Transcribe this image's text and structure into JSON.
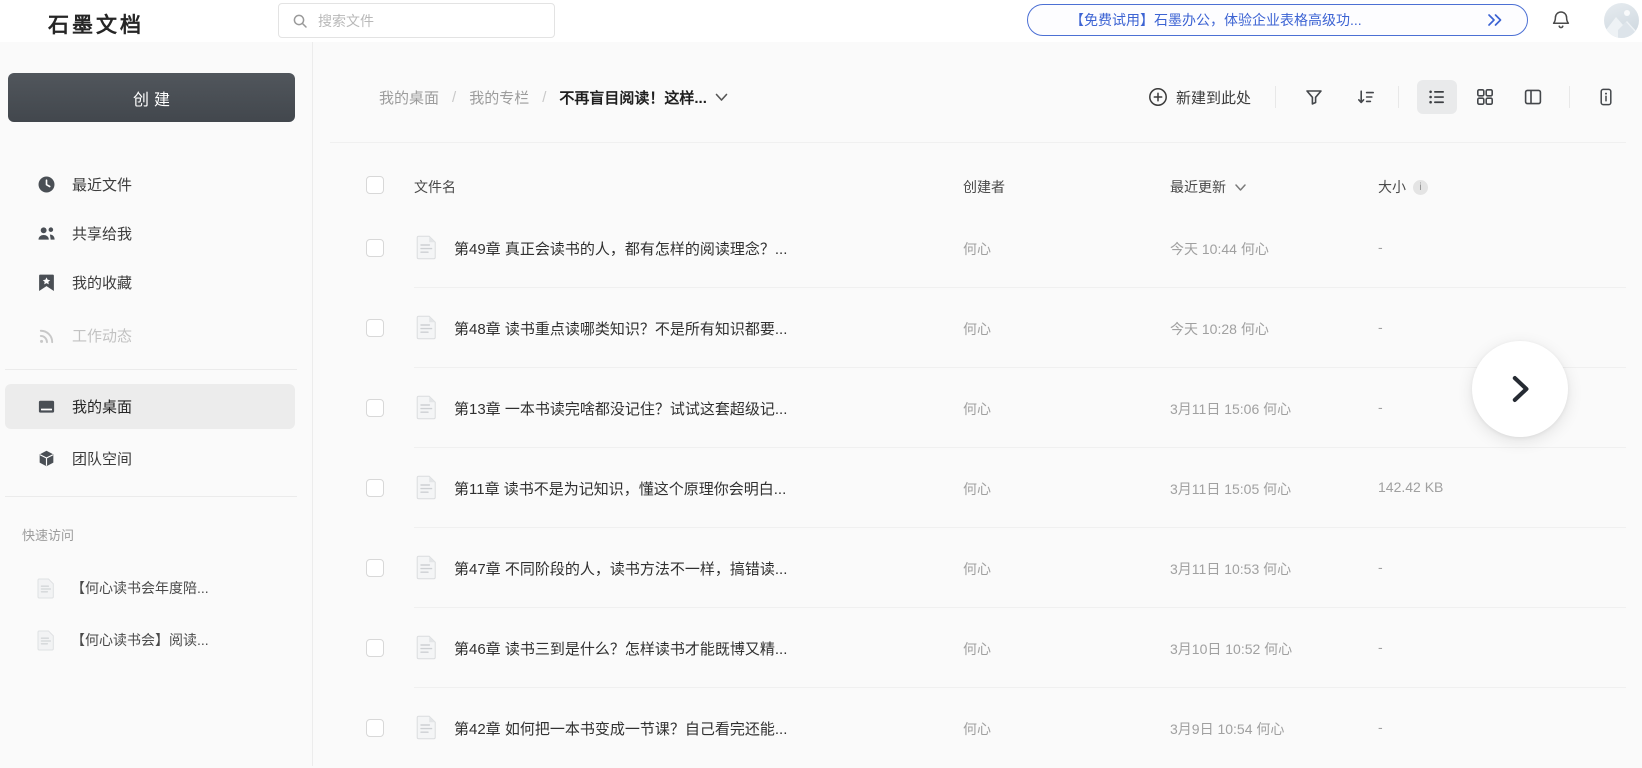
{
  "topbar": {
    "logo": "石墨文档",
    "search_placeholder": "搜索文件",
    "banner_text": "【免费试用】石墨办公，体验企业表格高级功..."
  },
  "sidebar": {
    "create_label": "创建",
    "items": [
      {
        "label": "最近文件",
        "icon": "clock"
      },
      {
        "label": "共享给我",
        "icon": "people"
      },
      {
        "label": "我的收藏",
        "icon": "bookmark"
      },
      {
        "label": "工作动态",
        "icon": "rss",
        "disabled": true
      },
      {
        "label": "我的桌面",
        "icon": "desktop",
        "selected": true
      },
      {
        "label": "团队空间",
        "icon": "cube"
      }
    ],
    "quick_access_label": "快速访问",
    "quick_items": [
      {
        "label": "【何心读书会年度陪..."
      },
      {
        "label": "【何心读书会】阅读..."
      }
    ]
  },
  "breadcrumb": {
    "separator": "/",
    "items": [
      "我的桌面",
      "我的专栏"
    ],
    "current": "不再盲目阅读！这样..."
  },
  "toolbar": {
    "new_here_label": "新建到此处"
  },
  "table": {
    "headers": {
      "name": "文件名",
      "creator": "创建者",
      "updated": "最近更新",
      "size": "大小",
      "size_info": "i"
    },
    "rows": [
      {
        "name": "第49章 真正会读书的人，都有怎样的阅读理念？...",
        "creator": "何心",
        "updated": "今天 10:44 何心",
        "size": "-"
      },
      {
        "name": "第48章 读书重点读哪类知识？不是所有知识都要...",
        "creator": "何心",
        "updated": "今天 10:28 何心",
        "size": "-"
      },
      {
        "name": "第13章 一本书读完啥都没记住？试试这套超级记...",
        "creator": "何心",
        "updated": "3月11日 15:06 何心",
        "size": "-"
      },
      {
        "name": "第11章 读书不是为记知识，懂这个原理你会明白...",
        "creator": "何心",
        "updated": "3月11日 15:05 何心",
        "size": "142.42 KB"
      },
      {
        "name": "第47章 不同阶段的人，读书方法不一样，搞错读...",
        "creator": "何心",
        "updated": "3月11日 10:53 何心",
        "size": "-"
      },
      {
        "name": "第46章 读书三到是什么？怎样读书才能既博又精...",
        "creator": "何心",
        "updated": "3月10日 10:52 何心",
        "size": "-"
      },
      {
        "name": "第42章 如何把一本书变成一节课？自己看完还能...",
        "creator": "何心",
        "updated": "3月9日 10:54 何心",
        "size": "-"
      }
    ]
  },
  "colors": {
    "accent_blue": "#3c63d3",
    "banner_border": "#4c70d4",
    "create_button": "#43484d",
    "selected_item_bg": "#ececec",
    "row_divider": "#f0f0f0",
    "meta_text": "#a0a0a0"
  }
}
